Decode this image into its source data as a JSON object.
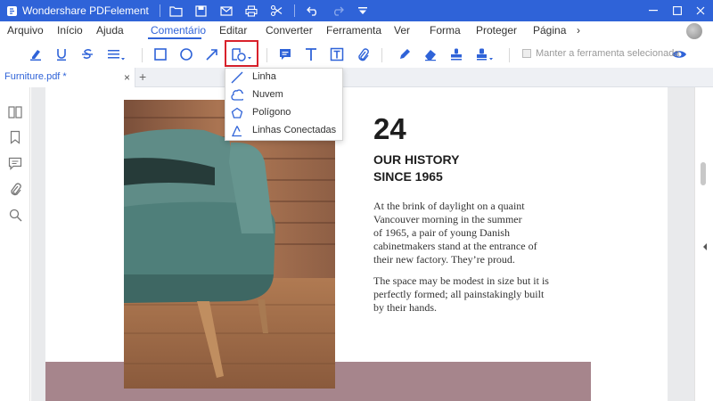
{
  "window": {
    "title": "Wondershare PDFelement",
    "accent_color": "#2f63d8",
    "quick_access_icons": [
      "folder-icon",
      "save-icon",
      "mail-icon",
      "print-icon",
      "scissors-icon",
      "undo-icon",
      "redo-icon",
      "dropdown-arrow-icon"
    ],
    "controls": [
      "minimize-icon",
      "maximize-icon",
      "close-icon"
    ]
  },
  "menu": {
    "items": [
      {
        "label": "Arquivo"
      },
      {
        "label": "Início"
      },
      {
        "label": "Ajuda"
      },
      {
        "label": "Comentário"
      },
      {
        "label": "Editar"
      },
      {
        "label": "Converter"
      },
      {
        "label": "Ferramenta"
      },
      {
        "label": "Ver"
      },
      {
        "label": "Forma"
      },
      {
        "label": "Proteger"
      },
      {
        "label": "Página"
      },
      {
        "label": "›"
      }
    ],
    "active": "Comentário"
  },
  "toolbar": {
    "icons": [
      "highlight-icon",
      "underline-icon",
      "strikethrough-icon",
      "text-align-menu-icon",
      "rectangle-icon",
      "circle-icon",
      "arrow-icon",
      "shapes-menu-icon",
      "note-icon",
      "text-icon",
      "textbox-icon",
      "attachment-icon",
      "pencil-icon",
      "eraser-icon",
      "stamp-icon",
      "signature-menu-icon",
      "eye-icon"
    ],
    "keep_tool_label": "Manter a ferramenta selecionada",
    "highlight_color": "#d9212b"
  },
  "tabs": {
    "active_tab": "Furniture.pdf *",
    "close_symbol": "×",
    "add_symbol": "+"
  },
  "side_panel": {
    "icons": [
      "thumbnails-icon",
      "bookmark-icon",
      "comments-icon",
      "attachments-icon",
      "search-icon"
    ]
  },
  "shape_dropdown": {
    "items": [
      {
        "label": "Linha",
        "icon": "line-icon"
      },
      {
        "label": "Nuvem",
        "icon": "cloud-icon"
      },
      {
        "label": "Polígono",
        "icon": "polygon-icon"
      },
      {
        "label": "Linhas Conectadas",
        "icon": "connected-lines-icon"
      }
    ]
  },
  "document": {
    "number": "24",
    "heading_line1": "OUR HISTORY",
    "heading_line2": "SINCE 1965",
    "paragraph1": [
      "At the brink of daylight on a quaint",
      "Vancouver morning in the summer",
      "of 1965, a pair of young Danish",
      "cabinetmakers stand at the entrance of",
      "their new factory. They’re proud."
    ],
    "paragraph2": [
      "The space may be modest in size but it is",
      "perfectly formed; all painstakingly built",
      "by their hands."
    ]
  }
}
